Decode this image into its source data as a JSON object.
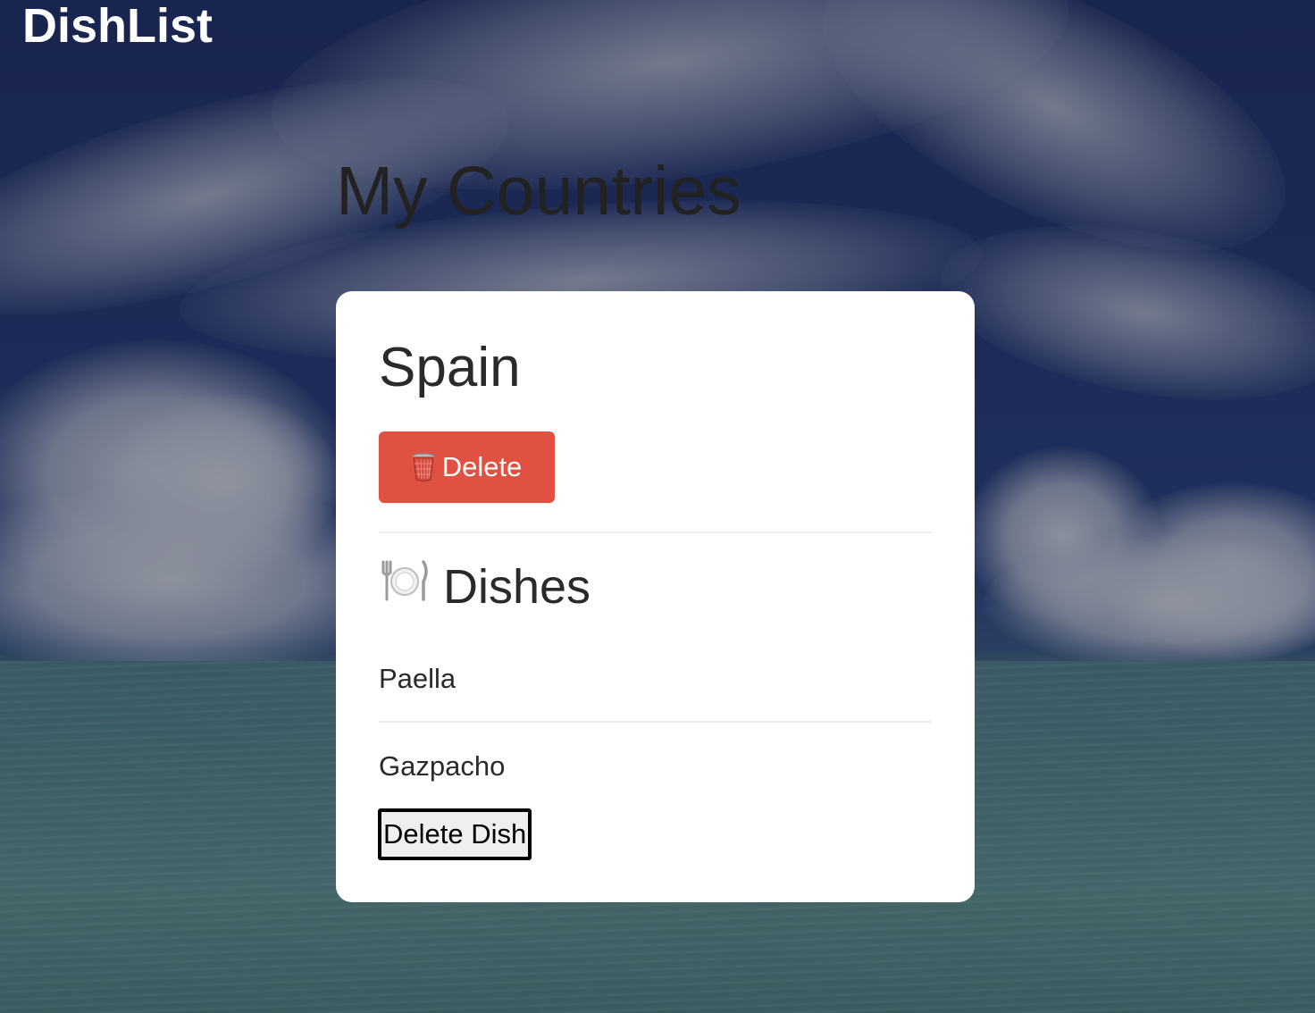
{
  "brand": {
    "title": "DishList"
  },
  "page": {
    "title": "My Countries"
  },
  "country": {
    "name": "Spain",
    "delete_label": "Delete",
    "delete_icon": "wastebasket-icon",
    "dishes_heading": "Dishes",
    "dishes_icon": "fork-knife-plate-icon",
    "dishes": [
      {
        "name": "Paella"
      },
      {
        "name": "Gazpacho",
        "delete_label": "Delete Dish"
      }
    ]
  },
  "colors": {
    "delete_button": "#e05142",
    "card_background": "#ffffff",
    "brand_text": "#ffffff"
  }
}
